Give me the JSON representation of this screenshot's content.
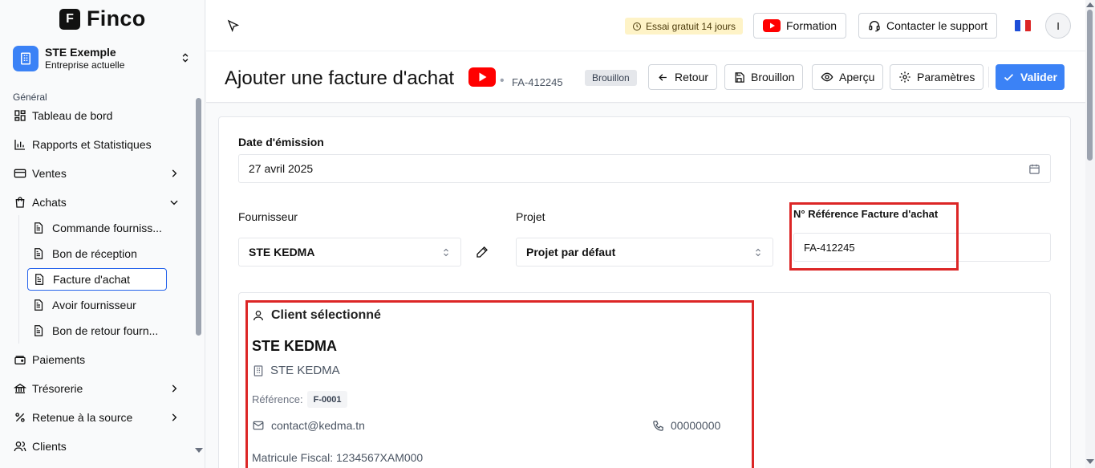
{
  "app": {
    "name": "Finco",
    "logo_letter": "F"
  },
  "company": {
    "name": "STE Exemple",
    "subtitle": "Entreprise actuelle"
  },
  "sidebar": {
    "section_label": "Général",
    "items": [
      {
        "label": "Tableau de bord",
        "icon": "dashboard-icon"
      },
      {
        "label": "Rapports et Statistiques",
        "icon": "bar-chart-icon"
      },
      {
        "label": "Ventes",
        "icon": "credit-card-icon",
        "expandable": true
      },
      {
        "label": "Achats",
        "icon": "shopping-bag-icon",
        "expanded": true
      },
      {
        "label": "Paiements",
        "icon": "wallet-icon"
      },
      {
        "label": "Trésorerie",
        "icon": "bank-icon",
        "expandable": true
      },
      {
        "label": "Retenue à la source",
        "icon": "percent-icon",
        "expandable": true
      },
      {
        "label": "Clients",
        "icon": "users-icon"
      }
    ],
    "achats_sub": [
      {
        "label": "Commande fourniss..."
      },
      {
        "label": "Bon de réception"
      },
      {
        "label": "Facture d'achat",
        "active": true
      },
      {
        "label": "Avoir fournisseur"
      },
      {
        "label": "Bon de retour fourn..."
      }
    ]
  },
  "topbar": {
    "trial": "Essai gratuit 14 jours",
    "formation": "Formation",
    "support": "Contacter le support",
    "avatar_initial": "I"
  },
  "header": {
    "title": "Ajouter une facture d'achat",
    "reference": "FA-412245",
    "status": "Brouillon",
    "buttons": {
      "back": "Retour",
      "draft": "Brouillon",
      "preview": "Aperçu",
      "settings": "Paramètres",
      "validate": "Valider"
    }
  },
  "form": {
    "date_label": "Date d'émission",
    "date_value": "27 avril 2025",
    "supplier_label": "Fournisseur",
    "supplier_value": "STE KEDMA",
    "project_label": "Projet",
    "project_value": "Projet par défaut",
    "ref_label": "N° Référence Facture d'achat",
    "ref_value": "FA-412245"
  },
  "client": {
    "heading": "Client sélectionné",
    "name": "STE KEDMA",
    "company": "STE KEDMA",
    "reference_label": "Référence:",
    "reference_value": "F-0001",
    "email": "contact@kedma.tn",
    "phone": "00000000",
    "matricule": "Matricule Fiscal: 1234567XAM000"
  },
  "colors": {
    "accent": "#3b82f6",
    "highlight": "#dc2626",
    "youtube": "#ff0000",
    "trial_bg": "#fef3c7"
  }
}
